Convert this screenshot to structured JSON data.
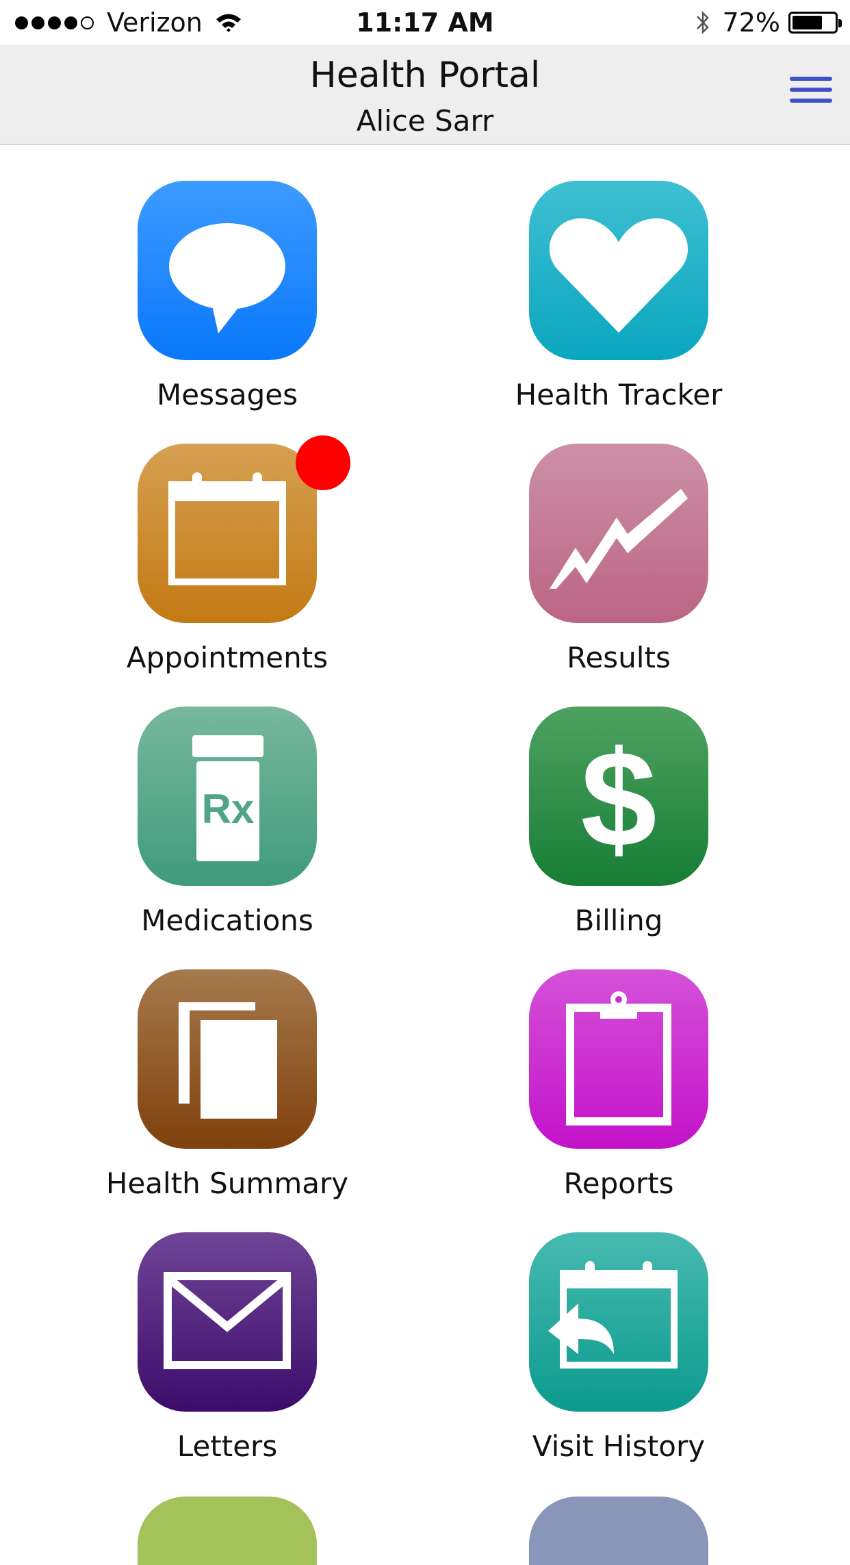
{
  "status_bar": {
    "carrier": "Verizon",
    "time": "11:17 AM",
    "battery": "72%",
    "battery_level": 0.72
  },
  "header": {
    "title": "Health Portal",
    "subtitle": "Alice Sarr",
    "menu_icon": "hamburger-menu-icon"
  },
  "tiles": [
    {
      "label": "Messages",
      "icon": "speech-bubble-icon",
      "color_top": "#3d9bff",
      "color_bottom": "#0a78fb"
    },
    {
      "label": "Health Tracker",
      "icon": "heart-icon",
      "color_top": "#3fbfd2",
      "color_bottom": "#0aa6bf"
    },
    {
      "label": "Appointments",
      "icon": "calendar-icon",
      "color_top": "#d6a052",
      "color_bottom": "#c37a13",
      "badge_color": "#ff0000"
    },
    {
      "label": "Results",
      "icon": "trend-line-icon",
      "color_top": "#cd90a7",
      "color_bottom": "#bb6584"
    },
    {
      "label": "Medications",
      "icon": "rx-bottle-icon",
      "color_top": "#78b89e",
      "color_bottom": "#3f9a7c"
    },
    {
      "label": "Billing",
      "icon": "dollar-icon",
      "color_top": "#4fa261",
      "color_bottom": "#167e34"
    },
    {
      "label": "Health Summary",
      "icon": "documents-icon",
      "color_top": "#a67a4c",
      "color_bottom": "#7f400c"
    },
    {
      "label": "Reports",
      "icon": "clipboard-icon",
      "color_top": "#d451d8",
      "color_bottom": "#c312c9"
    },
    {
      "label": "Letters",
      "icon": "envelope-icon",
      "color_top": "#6f4596",
      "color_bottom": "#3d0c6b"
    },
    {
      "label": "Visit History",
      "icon": "calendar-return-icon",
      "color_top": "#48b9b0",
      "color_bottom": "#0b9b8d"
    }
  ],
  "peek_tiles": [
    {
      "color": "#a3c25a"
    },
    {
      "color": "#8a96b9"
    }
  ]
}
